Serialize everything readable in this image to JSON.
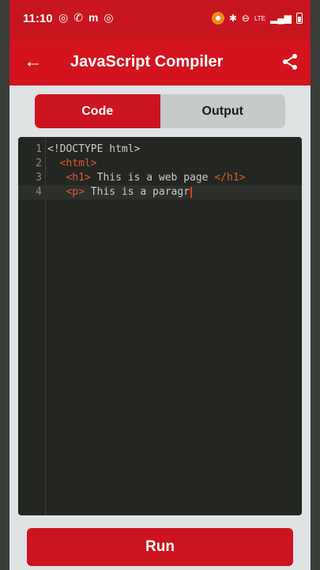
{
  "status": {
    "time": "11:10",
    "left_icons": [
      "◎",
      "✆",
      "m",
      "◎"
    ],
    "right_text": "LTE"
  },
  "app": {
    "title": "JavaScript Compiler",
    "accent": "#d3141f"
  },
  "tabs": [
    {
      "label": "Code",
      "active": true
    },
    {
      "label": "Output",
      "active": false
    }
  ],
  "editor": {
    "lines": [
      {
        "num": "1",
        "indent": "",
        "open": "",
        "text": "<!DOCTYPE html>",
        "close": ""
      },
      {
        "num": "2",
        "indent": "  ",
        "open": "<html>",
        "text": "",
        "close": ""
      },
      {
        "num": "3",
        "indent": "   ",
        "open": "<h1>",
        "text": " This is a web page ",
        "close": "</h1>"
      },
      {
        "num": "4",
        "indent": "   ",
        "open": "<p>",
        "text": " This is a paragr",
        "close": ""
      }
    ]
  },
  "run_label": "Run"
}
